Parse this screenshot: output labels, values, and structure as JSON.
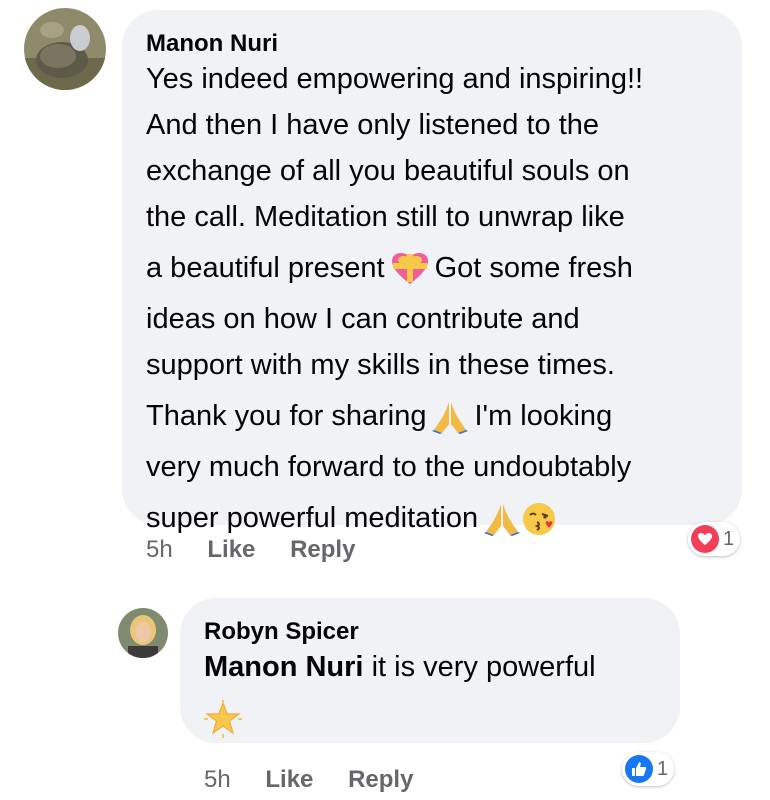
{
  "comment": {
    "author": "Manon Nuri",
    "lines": [
      "Yes indeed empowering and inspiring!!",
      "And then I have only listened to the",
      "exchange of all you beautiful souls on",
      "the call. Meditation still to unwrap like",
      "a beautiful present",
      "Got some fresh",
      "ideas on how I can contribute and",
      "support with my skills in these times.",
      "Thank you for sharing",
      "I'm looking",
      "very much forward to the undoubtably",
      "super powerful meditation"
    ],
    "emojis": [
      "heart-with-ribbon-emoji",
      "folded-hands-emoji",
      "folded-hands-emoji",
      "kissing-face-emoji"
    ],
    "time": "5h",
    "like_label": "Like",
    "reply_label": "Reply",
    "reaction": {
      "icon": "heart-icon",
      "count": "1",
      "color": "#f33e58"
    }
  },
  "reply": {
    "author": "Robyn Spicer",
    "mention": "Manon Nuri",
    "text": "it is very powerful",
    "emoji": "glowing-star-emoji",
    "time": "5h",
    "like_label": "Like",
    "reply_label": "Reply",
    "reaction": {
      "icon": "thumbs-up-icon",
      "count": "1",
      "color": "#1877f2"
    }
  },
  "colors": {
    "bubble": "#f0f2f5",
    "text": "#050505",
    "meta": "#65676b"
  }
}
